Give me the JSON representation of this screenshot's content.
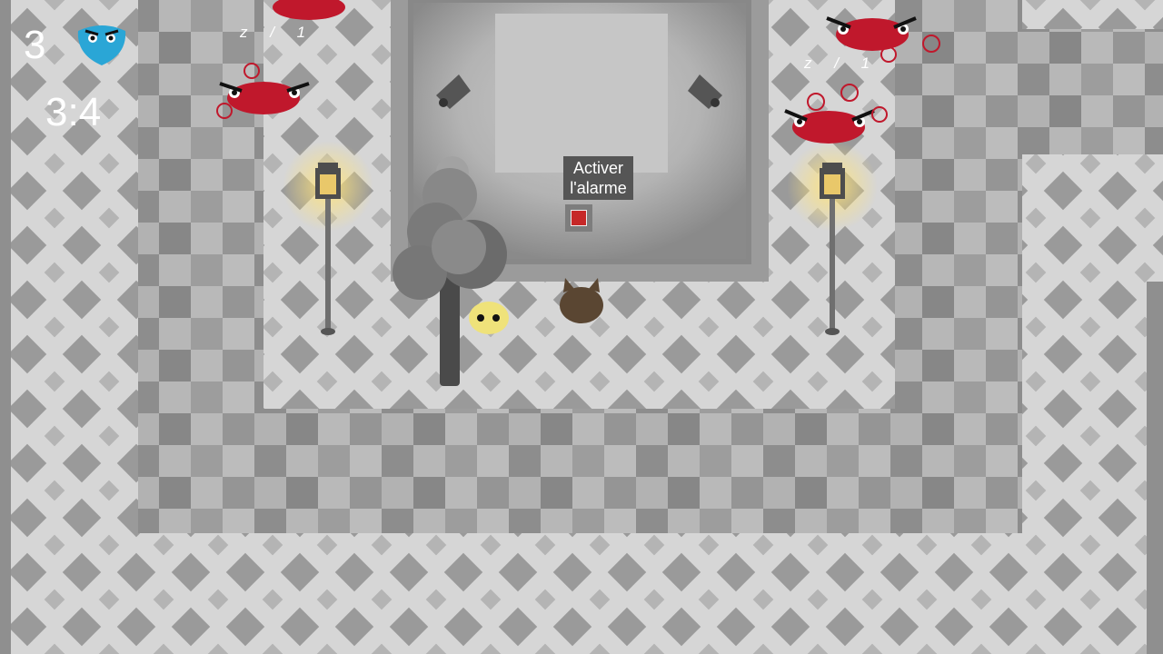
{
  "hud": {
    "lives": "3",
    "timer": "3:4",
    "player_color": "#2aa6d6"
  },
  "alarm": {
    "tooltip_line1": "Activer",
    "tooltip_line2": "l'alarme",
    "button_color": "#c62828"
  },
  "sleep_markers": [
    {
      "text": "z / 1"
    },
    {
      "text": "z / 1"
    }
  ],
  "colors": {
    "enemy": "#c0182c",
    "lamp_glow": "#ffe37a",
    "ally_yellow": "#efe27a",
    "ally_brown": "#5a4632"
  }
}
